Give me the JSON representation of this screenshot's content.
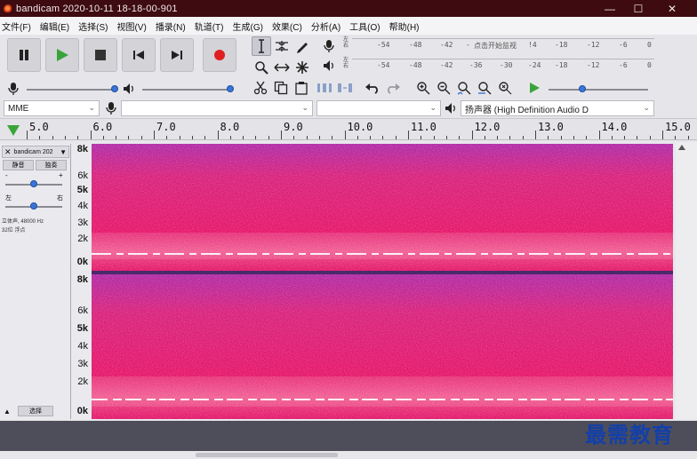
{
  "window": {
    "title": "bandicam 2020-10-11 18-18-00-901",
    "minimize": "—",
    "maximize": "☐",
    "close": "✕"
  },
  "menu": [
    "文件(F)",
    "编辑(E)",
    "选择(S)",
    "视图(V)",
    "播录(N)",
    "轨道(T)",
    "生成(G)",
    "效果(C)",
    "分析(A)",
    "工具(O)",
    "帮助(H)"
  ],
  "meters": {
    "record_scale": [
      "-54",
      "-48",
      "-42",
      "-",
      "点击开始监视",
      "!4",
      "-18",
      "-12",
      "-6",
      "0"
    ],
    "playback_scale": [
      "-54",
      "-48",
      "-42",
      "-36",
      "-30",
      "-24",
      "-18",
      "-12",
      "-6",
      "0"
    ],
    "left_right": [
      "左",
      "右"
    ]
  },
  "device": {
    "host": "MME",
    "output": "扬声器 (High Definition Audio D",
    "input": ""
  },
  "timeline": {
    "labels": [
      "5.0",
      "6.0",
      "7.0",
      "8.0",
      "9.0",
      "10.0",
      "11.0",
      "12.0",
      "13.0",
      "14.0",
      "15.0"
    ]
  },
  "track": {
    "name": "bandicam 202",
    "mute": "静音",
    "solo": "独奏",
    "gain_minus": "-",
    "gain_plus": "+",
    "pan_left": "左",
    "pan_right": "右",
    "info_line1": "立体声, 48000 Hz",
    "info_line2": "32位 浮点",
    "select_label": "选择",
    "collapse": "▲"
  },
  "freq_axis": {
    "top": [
      "8k",
      "6k",
      "5k",
      "4k",
      "3k",
      "2k",
      "0k"
    ],
    "bottom": [
      "8k",
      "6k",
      "5k",
      "4k",
      "3k",
      "2k",
      "0k"
    ]
  },
  "colors": {
    "title_bar": "#3d0b10",
    "spectro_high": "#e0146a",
    "spectro_mid": "#f05a92",
    "spectro_top": "#b32aa8",
    "play_green": "#3aa43a",
    "record_red": "#e02020"
  },
  "watermark": "最需教育"
}
